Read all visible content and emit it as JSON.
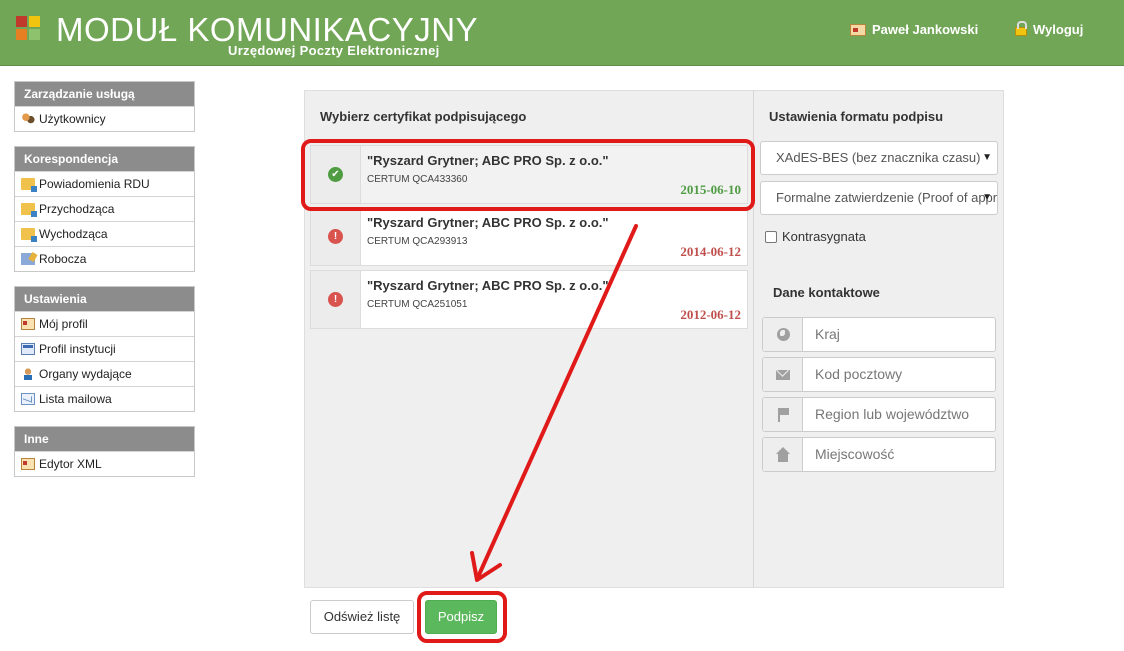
{
  "header": {
    "title": "MODUŁ KOMUNIKACYJNY",
    "subtitle": "Urzędowej Poczty Elektronicznej",
    "user_name": "Paweł Jankowski",
    "logout_label": "Wyloguj"
  },
  "sidebar": {
    "groups": [
      {
        "title": "Zarządzanie usługą",
        "items": [
          {
            "label": "Użytkownicy",
            "icon": "users-icon"
          }
        ]
      },
      {
        "title": "Korespondencja",
        "items": [
          {
            "label": "Powiadomienia RDU",
            "icon": "folder-icon"
          },
          {
            "label": "Przychodząca",
            "icon": "folder-icon"
          },
          {
            "label": "Wychodząca",
            "icon": "folder-icon"
          },
          {
            "label": "Robocza",
            "icon": "draft-icon"
          }
        ]
      },
      {
        "title": "Ustawienia",
        "items": [
          {
            "label": "Mój profil",
            "icon": "profile-card-icon"
          },
          {
            "label": "Profil instytucji",
            "icon": "institution-card-icon"
          },
          {
            "label": "Organy wydające",
            "icon": "person-icon"
          },
          {
            "label": "Lista mailowa",
            "icon": "mail-icon"
          }
        ]
      },
      {
        "title": "Inne",
        "items": [
          {
            "label": "Edytor XML",
            "icon": "editor-card-icon"
          }
        ]
      }
    ]
  },
  "certificates": {
    "title": "Wybierz certyfikat podpisującego",
    "items": [
      {
        "name": "\"Ryszard Grytner; ABC PRO Sp. z o.o.\"",
        "serial": "CERTUM QCA433360",
        "date": "2015-06-10",
        "status": "valid",
        "status_icon": "check-circle-icon",
        "selected": true
      },
      {
        "name": "\"Ryszard Grytner; ABC PRO Sp. z o.o.\"",
        "serial": "CERTUM QCA293913",
        "date": "2014-06-12",
        "status": "expired",
        "status_icon": "exclamation-circle-icon",
        "selected": false
      },
      {
        "name": "\"Ryszard Grytner; ABC PRO Sp. z o.o.\"",
        "serial": "CERTUM QCA251051",
        "date": "2012-06-12",
        "status": "expired",
        "status_icon": "exclamation-circle-icon",
        "selected": false
      }
    ]
  },
  "signature_settings": {
    "title": "Ustawienia formatu podpisu",
    "format_value": "XAdES-BES (bez znacznika czasu)",
    "commitment_value": "Formalne zatwierdzenie (Proof of approval)",
    "countersign_label": "Kontrasygnata",
    "countersign_checked": false
  },
  "contact": {
    "title": "Dane kontaktowe",
    "country_placeholder": "Kraj",
    "postal_placeholder": "Kod pocztowy",
    "region_placeholder": "Region lub  województwo",
    "city_placeholder": "Miejscowość"
  },
  "actions": {
    "refresh_label": "Odśwież listę",
    "sign_label": "Podpisz"
  },
  "colors": {
    "header_green": "#72a657",
    "valid_date": "#4f9c43",
    "expired_date": "#c0504d",
    "primary_button": "#5cb85c",
    "annotation_red": "#e01919"
  }
}
